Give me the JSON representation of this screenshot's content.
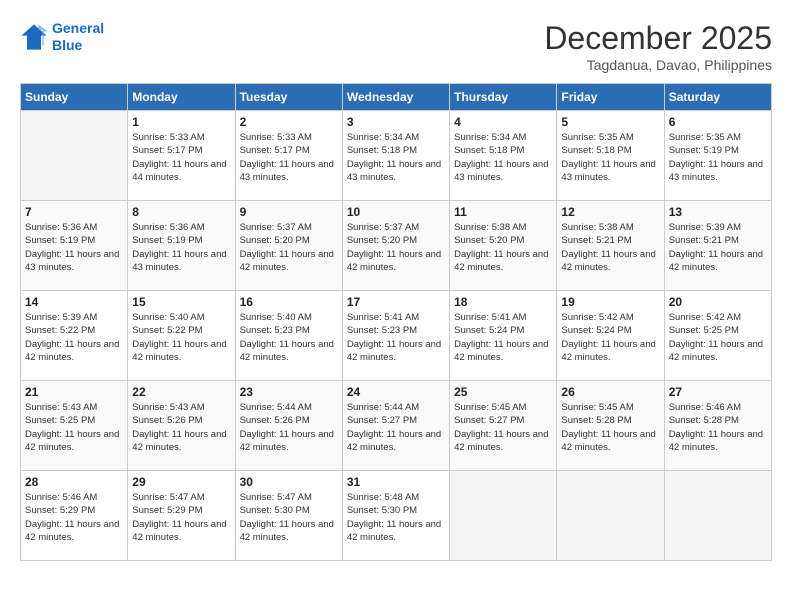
{
  "logo": {
    "line1": "General",
    "line2": "Blue"
  },
  "title": "December 2025",
  "subtitle": "Tagdanua, Davao, Philippines",
  "weekdays": [
    "Sunday",
    "Monday",
    "Tuesday",
    "Wednesday",
    "Thursday",
    "Friday",
    "Saturday"
  ],
  "weeks": [
    [
      {
        "day": "",
        "sunrise": "",
        "sunset": "",
        "daylight": ""
      },
      {
        "day": "1",
        "sunrise": "Sunrise: 5:33 AM",
        "sunset": "Sunset: 5:17 PM",
        "daylight": "Daylight: 11 hours and 44 minutes."
      },
      {
        "day": "2",
        "sunrise": "Sunrise: 5:33 AM",
        "sunset": "Sunset: 5:17 PM",
        "daylight": "Daylight: 11 hours and 43 minutes."
      },
      {
        "day": "3",
        "sunrise": "Sunrise: 5:34 AM",
        "sunset": "Sunset: 5:18 PM",
        "daylight": "Daylight: 11 hours and 43 minutes."
      },
      {
        "day": "4",
        "sunrise": "Sunrise: 5:34 AM",
        "sunset": "Sunset: 5:18 PM",
        "daylight": "Daylight: 11 hours and 43 minutes."
      },
      {
        "day": "5",
        "sunrise": "Sunrise: 5:35 AM",
        "sunset": "Sunset: 5:18 PM",
        "daylight": "Daylight: 11 hours and 43 minutes."
      },
      {
        "day": "6",
        "sunrise": "Sunrise: 5:35 AM",
        "sunset": "Sunset: 5:19 PM",
        "daylight": "Daylight: 11 hours and 43 minutes."
      }
    ],
    [
      {
        "day": "7",
        "sunrise": "Sunrise: 5:36 AM",
        "sunset": "Sunset: 5:19 PM",
        "daylight": "Daylight: 11 hours and 43 minutes."
      },
      {
        "day": "8",
        "sunrise": "Sunrise: 5:36 AM",
        "sunset": "Sunset: 5:19 PM",
        "daylight": "Daylight: 11 hours and 43 minutes."
      },
      {
        "day": "9",
        "sunrise": "Sunrise: 5:37 AM",
        "sunset": "Sunset: 5:20 PM",
        "daylight": "Daylight: 11 hours and 42 minutes."
      },
      {
        "day": "10",
        "sunrise": "Sunrise: 5:37 AM",
        "sunset": "Sunset: 5:20 PM",
        "daylight": "Daylight: 11 hours and 42 minutes."
      },
      {
        "day": "11",
        "sunrise": "Sunrise: 5:38 AM",
        "sunset": "Sunset: 5:20 PM",
        "daylight": "Daylight: 11 hours and 42 minutes."
      },
      {
        "day": "12",
        "sunrise": "Sunrise: 5:38 AM",
        "sunset": "Sunset: 5:21 PM",
        "daylight": "Daylight: 11 hours and 42 minutes."
      },
      {
        "day": "13",
        "sunrise": "Sunrise: 5:39 AM",
        "sunset": "Sunset: 5:21 PM",
        "daylight": "Daylight: 11 hours and 42 minutes."
      }
    ],
    [
      {
        "day": "14",
        "sunrise": "Sunrise: 5:39 AM",
        "sunset": "Sunset: 5:22 PM",
        "daylight": "Daylight: 11 hours and 42 minutes."
      },
      {
        "day": "15",
        "sunrise": "Sunrise: 5:40 AM",
        "sunset": "Sunset: 5:22 PM",
        "daylight": "Daylight: 11 hours and 42 minutes."
      },
      {
        "day": "16",
        "sunrise": "Sunrise: 5:40 AM",
        "sunset": "Sunset: 5:23 PM",
        "daylight": "Daylight: 11 hours and 42 minutes."
      },
      {
        "day": "17",
        "sunrise": "Sunrise: 5:41 AM",
        "sunset": "Sunset: 5:23 PM",
        "daylight": "Daylight: 11 hours and 42 minutes."
      },
      {
        "day": "18",
        "sunrise": "Sunrise: 5:41 AM",
        "sunset": "Sunset: 5:24 PM",
        "daylight": "Daylight: 11 hours and 42 minutes."
      },
      {
        "day": "19",
        "sunrise": "Sunrise: 5:42 AM",
        "sunset": "Sunset: 5:24 PM",
        "daylight": "Daylight: 11 hours and 42 minutes."
      },
      {
        "day": "20",
        "sunrise": "Sunrise: 5:42 AM",
        "sunset": "Sunset: 5:25 PM",
        "daylight": "Daylight: 11 hours and 42 minutes."
      }
    ],
    [
      {
        "day": "21",
        "sunrise": "Sunrise: 5:43 AM",
        "sunset": "Sunset: 5:25 PM",
        "daylight": "Daylight: 11 hours and 42 minutes."
      },
      {
        "day": "22",
        "sunrise": "Sunrise: 5:43 AM",
        "sunset": "Sunset: 5:26 PM",
        "daylight": "Daylight: 11 hours and 42 minutes."
      },
      {
        "day": "23",
        "sunrise": "Sunrise: 5:44 AM",
        "sunset": "Sunset: 5:26 PM",
        "daylight": "Daylight: 11 hours and 42 minutes."
      },
      {
        "day": "24",
        "sunrise": "Sunrise: 5:44 AM",
        "sunset": "Sunset: 5:27 PM",
        "daylight": "Daylight: 11 hours and 42 minutes."
      },
      {
        "day": "25",
        "sunrise": "Sunrise: 5:45 AM",
        "sunset": "Sunset: 5:27 PM",
        "daylight": "Daylight: 11 hours and 42 minutes."
      },
      {
        "day": "26",
        "sunrise": "Sunrise: 5:45 AM",
        "sunset": "Sunset: 5:28 PM",
        "daylight": "Daylight: 11 hours and 42 minutes."
      },
      {
        "day": "27",
        "sunrise": "Sunrise: 5:46 AM",
        "sunset": "Sunset: 5:28 PM",
        "daylight": "Daylight: 11 hours and 42 minutes."
      }
    ],
    [
      {
        "day": "28",
        "sunrise": "Sunrise: 5:46 AM",
        "sunset": "Sunset: 5:29 PM",
        "daylight": "Daylight: 11 hours and 42 minutes."
      },
      {
        "day": "29",
        "sunrise": "Sunrise: 5:47 AM",
        "sunset": "Sunset: 5:29 PM",
        "daylight": "Daylight: 11 hours and 42 minutes."
      },
      {
        "day": "30",
        "sunrise": "Sunrise: 5:47 AM",
        "sunset": "Sunset: 5:30 PM",
        "daylight": "Daylight: 11 hours and 42 minutes."
      },
      {
        "day": "31",
        "sunrise": "Sunrise: 5:48 AM",
        "sunset": "Sunset: 5:30 PM",
        "daylight": "Daylight: 11 hours and 42 minutes."
      },
      {
        "day": "",
        "sunrise": "",
        "sunset": "",
        "daylight": ""
      },
      {
        "day": "",
        "sunrise": "",
        "sunset": "",
        "daylight": ""
      },
      {
        "day": "",
        "sunrise": "",
        "sunset": "",
        "daylight": ""
      }
    ]
  ]
}
